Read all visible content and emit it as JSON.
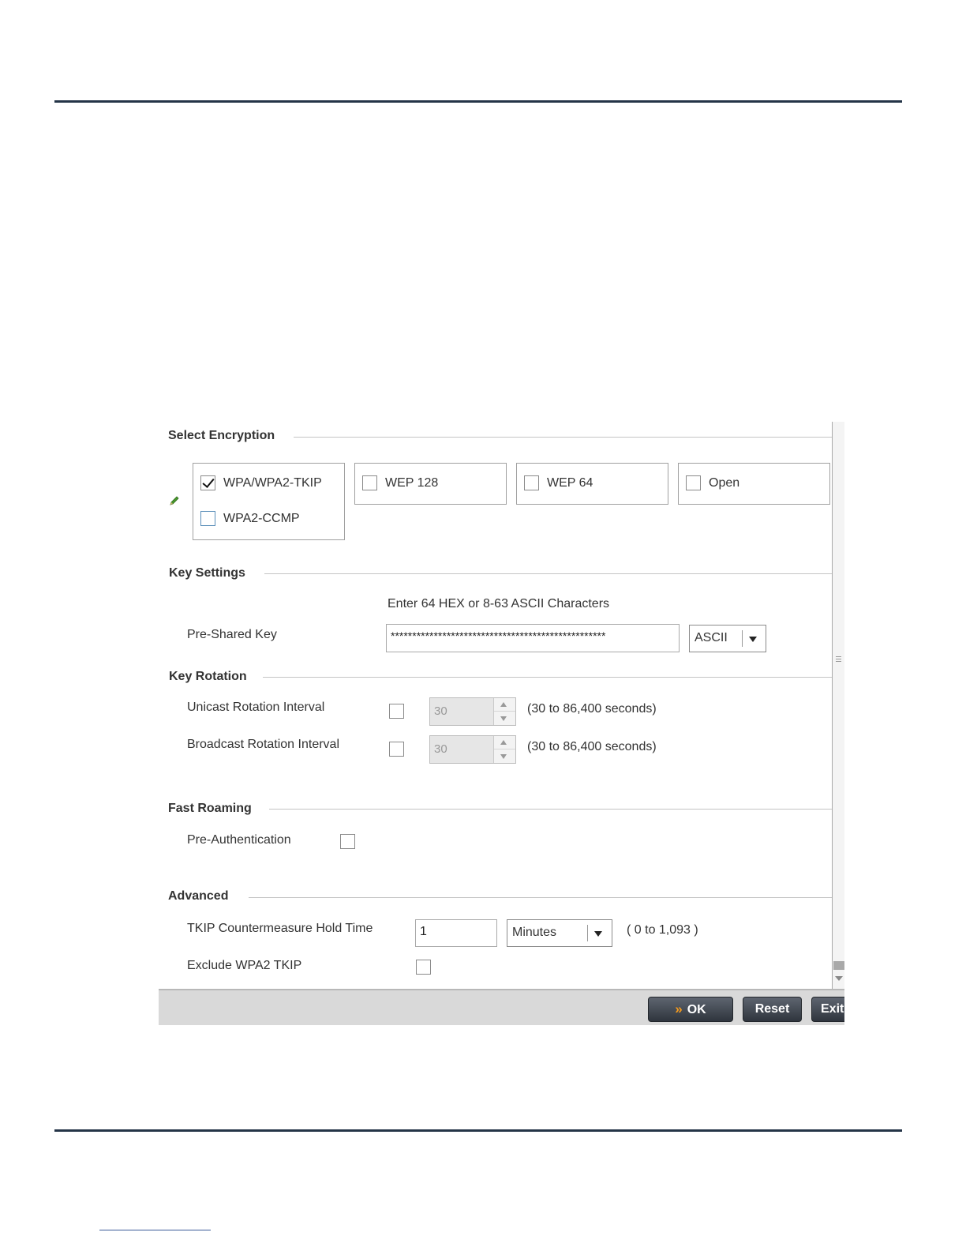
{
  "sections": {
    "encryption": "Select Encryption",
    "key_settings": "Key Settings",
    "key_rotation": "Key Rotation",
    "fast_roaming": "Fast Roaming",
    "advanced": "Advanced"
  },
  "encryption_options": [
    {
      "label": "WPA/WPA2-TKIP",
      "checked": true
    },
    {
      "label": "WPA2-CCMP",
      "checked": false
    },
    {
      "label": "WEP 128",
      "checked": false
    },
    {
      "label": "WEP 64",
      "checked": false
    },
    {
      "label": "Open",
      "checked": false
    }
  ],
  "key_settings": {
    "hint": "Enter 64 HEX or 8-63 ASCII Characters",
    "psk_label": "Pre-Shared Key",
    "psk_value": "**************************************************",
    "format": "ASCII"
  },
  "key_rotation": {
    "unicast_label": "Unicast Rotation Interval",
    "unicast_value": "30",
    "unicast_range": "(30 to 86,400 seconds)",
    "broadcast_label": "Broadcast Rotation Interval",
    "broadcast_value": "30",
    "broadcast_range": "(30 to 86,400 seconds)"
  },
  "fast_roaming": {
    "preauth_label": "Pre-Authentication"
  },
  "advanced": {
    "tkip_label": "TKIP Countermeasure Hold Time",
    "tkip_value": "1",
    "tkip_unit": "Minutes",
    "tkip_range": "( 0 to 1,093 )",
    "exclude_label": "Exclude WPA2 TKIP"
  },
  "buttons": {
    "ok": "OK",
    "reset": "Reset",
    "exit": "Exit"
  },
  "colors": {
    "rule": "#243447",
    "button_dark": "#2f353d",
    "ok_chevron": "#f39a1e"
  }
}
